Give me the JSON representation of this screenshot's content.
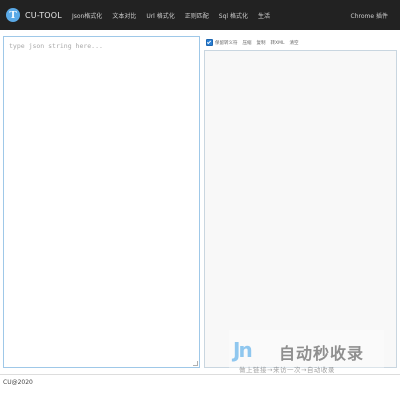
{
  "brand": {
    "logo_letter": "T",
    "name": "CU-TOOL"
  },
  "nav": {
    "items": [
      {
        "label": "Json格式化"
      },
      {
        "label": "文本对比"
      },
      {
        "label": "Url 格式化"
      },
      {
        "label": "正则匹配"
      },
      {
        "label": "Sql 格式化"
      },
      {
        "label": "生活"
      }
    ],
    "right_label": "Chrome 插件"
  },
  "editor": {
    "placeholder": "type json string here..."
  },
  "toolbar": {
    "checkbox_label": "保留转义符",
    "items": [
      {
        "label": "压缩"
      },
      {
        "label": "复制"
      },
      {
        "label": "转XML"
      },
      {
        "label": "清空"
      }
    ]
  },
  "watermark": {
    "logo_text": "Jn",
    "title": "自动秒收录",
    "slogan": "做上链接→来访一次→自动收录"
  },
  "footer": {
    "text": "CU@2020"
  },
  "colors": {
    "navbar_bg": "#222222",
    "logo_bg": "#5aa9e6",
    "panel_border": "#9fc8e8",
    "checkbox": "#2a7fd4"
  }
}
